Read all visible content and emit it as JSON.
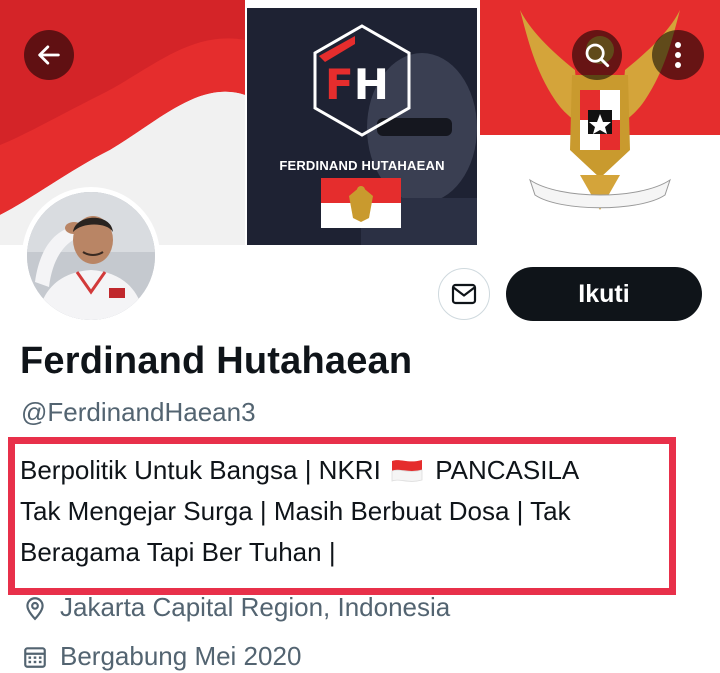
{
  "banner": {
    "logo_letters_f": "F",
    "logo_letters_h": "H",
    "logo_name": "FERDINAND HUTAHAEAN"
  },
  "icons": {
    "back": "arrow-left-icon",
    "search": "search-icon",
    "more": "more-vertical-icon",
    "message": "envelope-icon",
    "location": "location-pin-icon",
    "calendar": "calendar-icon"
  },
  "profile": {
    "display_name": "Ferdinand Hutahaean",
    "handle": "@FerdinandHaean3",
    "follow_label": "Ikuti",
    "bio": {
      "line1_before_flag": "Berpolitik Untuk Bangsa | NKRI ",
      "line1_after_flag": " PANCASILA",
      "line2": "Tak Mengejar Surga | Masih Berbuat Dosa | Tak",
      "line3": "Beragama Tapi Ber Tuhan |"
    },
    "location": "Jakarta Capital Region, Indonesia",
    "joined": "Bergabung Mei 2020"
  },
  "colors": {
    "accent_red": "#e8304a",
    "flag_red": "#e52d2d",
    "follow_bg": "#0f1419",
    "muted_text": "#536471"
  }
}
